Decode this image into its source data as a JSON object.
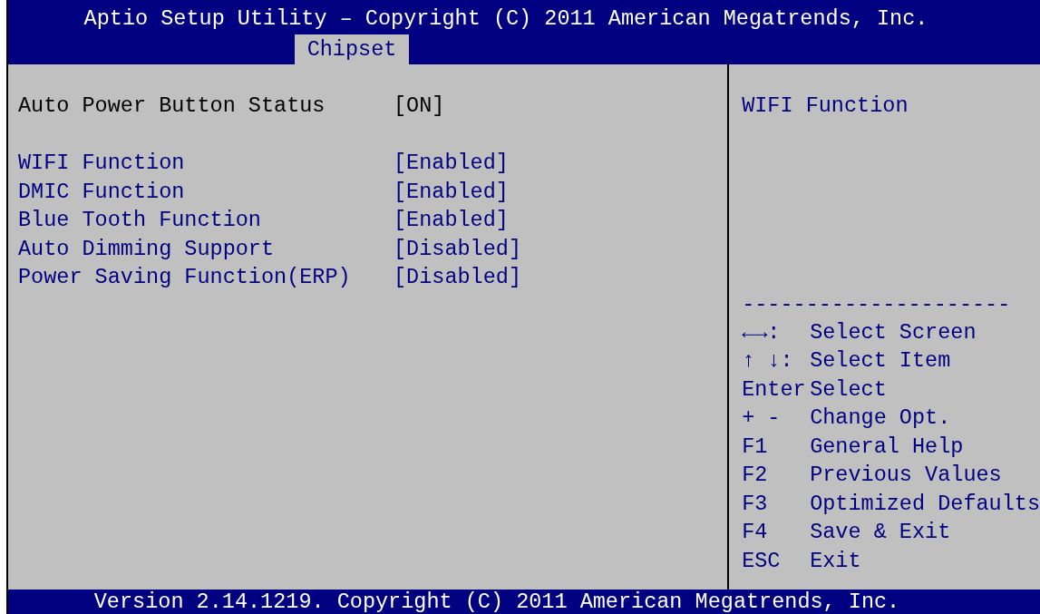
{
  "window": {
    "title": "Aptio Setup Utility – Copyright (C) 2011 American Megatrends, Inc."
  },
  "tabs": [
    {
      "label": "Chipset",
      "selected": true
    }
  ],
  "settings": [
    {
      "kind": "info",
      "label": "Auto Power Button Status",
      "value": "[ON]"
    },
    {
      "kind": "gap"
    },
    {
      "kind": "option",
      "label": "WIFI Function",
      "value": "[Enabled]"
    },
    {
      "kind": "option",
      "label": "DMIC Function",
      "value": "[Enabled]"
    },
    {
      "kind": "option",
      "label": "Blue Tooth Function",
      "value": "[Enabled]"
    },
    {
      "kind": "option",
      "label": "Auto Dimming Support",
      "value": "[Disabled]"
    },
    {
      "kind": "option",
      "label": "Power Saving Function(ERP)",
      "value": "[Disabled]"
    }
  ],
  "help": {
    "text": "WIFI Function",
    "separator": "---------------------",
    "keys": [
      {
        "key": "←→:",
        "action": "Select Screen"
      },
      {
        "key": "↑ ↓:",
        "action": "Select Item"
      },
      {
        "key": "Enter",
        "action": "Select"
      },
      {
        "key": "+ -",
        "action": "Change Opt."
      },
      {
        "key": "F1",
        "action": "General Help"
      },
      {
        "key": "F2",
        "action": "Previous Values"
      },
      {
        "key": "F3",
        "action": "Optimized Defaults"
      },
      {
        "key": "F4",
        "action": "Save & Exit"
      },
      {
        "key": "ESC",
        "action": "Exit"
      }
    ]
  },
  "status_bar": "Version 2.14.1219. Copyright (C) 2011 American Megatrends, Inc."
}
